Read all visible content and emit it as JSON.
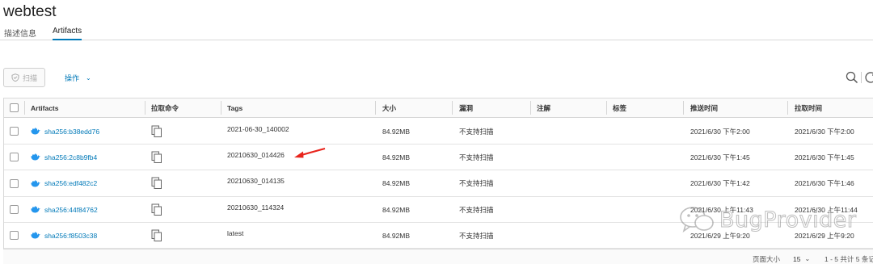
{
  "page": {
    "title": "webtest"
  },
  "tabs": [
    {
      "label": "描述信息"
    },
    {
      "label": "Artifacts"
    }
  ],
  "toolbar": {
    "scan_label": "扫描",
    "ops_label": "操作"
  },
  "table": {
    "columns": [
      "Artifacts",
      "拉取命令",
      "Tags",
      "大小",
      "漏洞",
      "注解",
      "标签",
      "推送时间",
      "拉取时间"
    ],
    "rows": [
      {
        "artifact": "sha256:b38edd76",
        "tag": "2021-06-30_140002",
        "size": "84.92MB",
        "vuln": "不支持扫描",
        "push": "2021/6/30 下午2:00",
        "pull": "2021/6/30 下午2:00"
      },
      {
        "artifact": "sha256:2c8b9fb4",
        "tag": "20210630_014426",
        "size": "84.92MB",
        "vuln": "不支持扫描",
        "push": "2021/6/30 下午1:45",
        "pull": "2021/6/30 下午1:45"
      },
      {
        "artifact": "sha256:edf482c2",
        "tag": "20210630_014135",
        "size": "84.92MB",
        "vuln": "不支持扫描",
        "push": "2021/6/30 下午1:42",
        "pull": "2021/6/30 下午1:46"
      },
      {
        "artifact": "sha256:44f84762",
        "tag": "20210630_114324",
        "size": "84.92MB",
        "vuln": "不支持扫描",
        "push": "2021/6/30 上午11:43",
        "pull": "2021/6/30 上午11:44"
      },
      {
        "artifact": "sha256:f8503c38",
        "tag": "latest",
        "size": "84.92MB",
        "vuln": "不支持扫描",
        "push": "2021/6/29 上午9:20",
        "pull": "2021/6/29 上午9:20"
      }
    ]
  },
  "footer": {
    "page_size_label": "页面大小",
    "page_size_value": "15",
    "count_text": "1 - 5 共计 5 条记"
  },
  "watermark": {
    "text": "BugProvider"
  },
  "colors": {
    "link": "#0079b8",
    "arrow": "#e8241c"
  }
}
